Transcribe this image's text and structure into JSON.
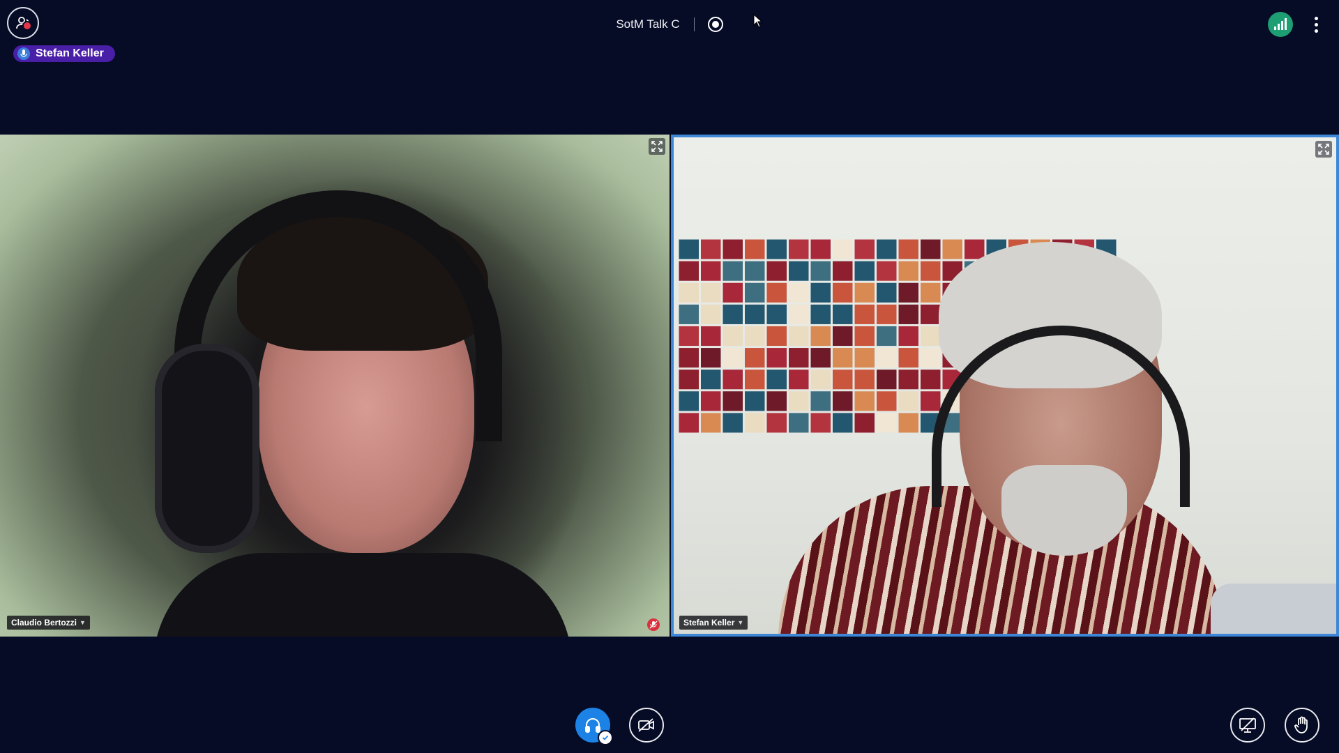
{
  "header": {
    "meeting_title": "SotM Talk C",
    "talking_indicator": "Stefan Keller"
  },
  "icons": {
    "user_list": "user-list-icon",
    "record": "record-icon",
    "connection_status": "signal-bars-icon",
    "options": "vertical-dots-icon",
    "fullscreen": "expand-arrows-icon",
    "muted": "muted-mic-icon",
    "audio": "headphones-icon",
    "audio_connected": "check-icon",
    "share_camera": "camera-off-icon",
    "presentation": "presentation-icon",
    "raise_hand": "hand-icon"
  },
  "colors": {
    "background": "#060b26",
    "talking_pill": "#4a1fa8",
    "connection_good": "#1e9e73",
    "active_speaker_border": "#3e86d6",
    "audio_button": "#1d82e6",
    "muted": "#d9313e"
  },
  "participants": [
    {
      "name": "Claudio Bertozzi",
      "muted": true,
      "active_speaker": false
    },
    {
      "name": "Stefan Keller",
      "muted": false,
      "active_speaker": true
    }
  ]
}
